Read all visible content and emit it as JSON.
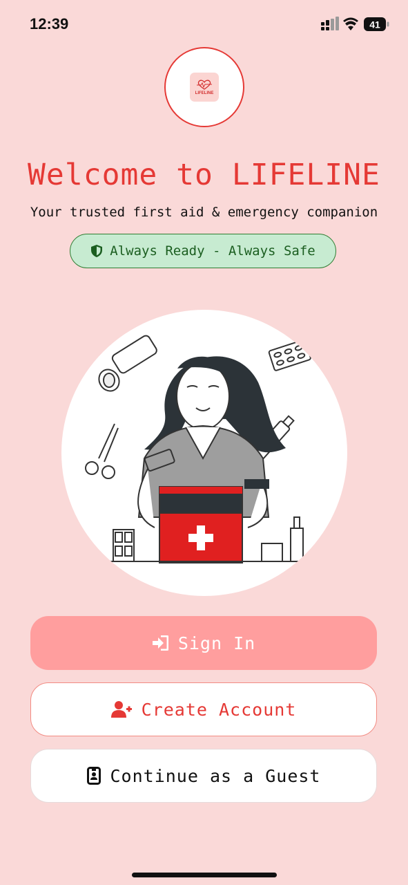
{
  "status_bar": {
    "time": "12:39",
    "battery": "41"
  },
  "logo": {
    "text": "LIFELINE"
  },
  "welcome": {
    "title": "Welcome to LIFELINE",
    "subtitle": "Your trusted first aid & emergency companion",
    "tag": "Always Ready - Always Safe"
  },
  "buttons": {
    "sign_in": "Sign In",
    "create_account": "Create Account",
    "guest": "Continue as a Guest"
  },
  "colors": {
    "background": "#FAD9D8",
    "accent": "#E53935",
    "sign_in_bg": "#FF9E9E",
    "tag_bg": "#C7EBD1",
    "tag_text": "#1B5E20"
  }
}
